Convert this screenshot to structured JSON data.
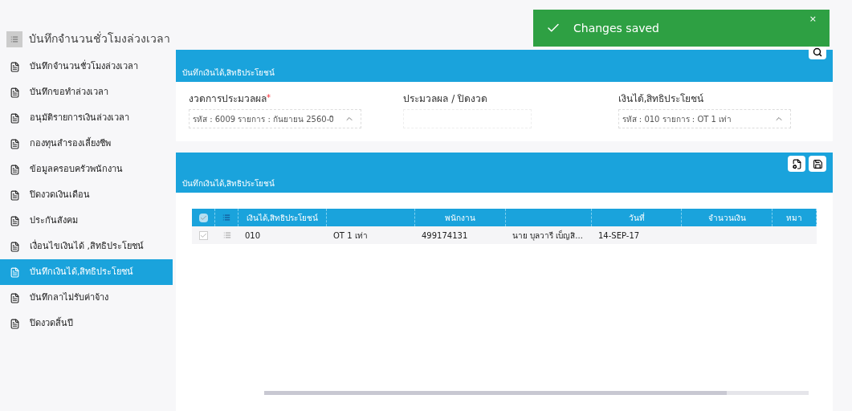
{
  "sidebar": {
    "title": "บันทึกจำนวนชั่วโมงล่วงเวลา",
    "items": [
      {
        "label": "บันทึกจำนวนชั่วโมงล่วงเวลา",
        "selected": false
      },
      {
        "label": "บันทึกขอทำล่วงเวลา",
        "selected": false
      },
      {
        "label": "อนุมัติรายการเงินล่วงเวลา",
        "selected": false
      },
      {
        "label": "กองทุนสำรองเลี้ยงชีพ",
        "selected": false
      },
      {
        "label": "ข้อมูลครอบครัวพนักงาน",
        "selected": false
      },
      {
        "label": "ปิดงวดเงินเดือน",
        "selected": false
      },
      {
        "label": "ประกันสังคม",
        "selected": false
      },
      {
        "label": "เงื่อนไขเงินได้ ,สิทธิประโยชน์",
        "selected": false
      },
      {
        "label": "บันทึกเงินได้,สิทธิประโยชน์",
        "selected": true
      },
      {
        "label": "บันทึกลาไม่รับค่าจ้าง",
        "selected": false
      },
      {
        "label": "ปิดงวดสิ้นปี",
        "selected": false
      }
    ]
  },
  "toast": {
    "message": "Changes saved",
    "close": "×"
  },
  "filter_panel": {
    "title": "บันทึกเงินได้,สิทธิประโยชน์",
    "fields": [
      {
        "label": "งวดการประมวลผล",
        "required_mark": "*",
        "value": "รหัส : 6009 รายการ : กันยายน 2560-0ิ",
        "kind": "select"
      },
      {
        "label": "ประมวลผล / ปิดงวด",
        "kind": "blank"
      },
      {
        "label": "เงินได้,สิทธิประโยชน์",
        "value": "รหัส : 010 รายการ : OT 1 เท่า",
        "kind": "select"
      }
    ]
  },
  "table_panel": {
    "title": "บันทึกเงินได้,สิทธิประโยชน์",
    "columns": [
      "",
      "",
      "เงินได้,สิทธิประโยชน์",
      "",
      "พนักงาน",
      "",
      "วันที่",
      "จำนวนเงิน",
      "หมา"
    ],
    "select_all_checked": true,
    "rows": [
      {
        "checked": true,
        "cells": [
          "",
          "",
          "010",
          "OT 1 เท่า",
          "499174131",
          "นาย บุลวารี เบ็ญสิ...",
          "14-SEP-17",
          "",
          ""
        ]
      }
    ]
  }
}
